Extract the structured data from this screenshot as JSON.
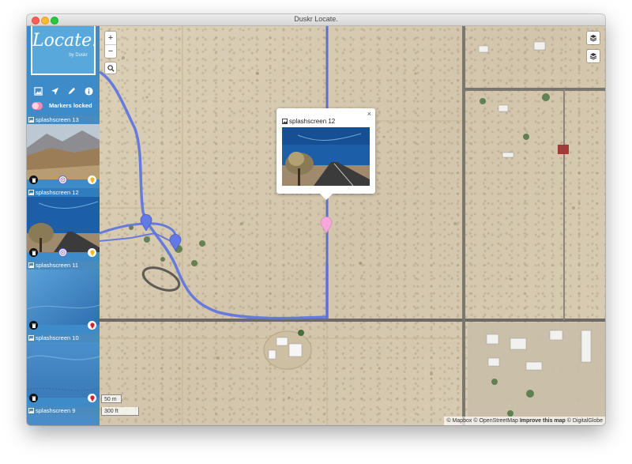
{
  "window": {
    "title": "Duskr Locate."
  },
  "sidebar": {
    "logo": {
      "text": "Locate.",
      "byline": "by Duskr"
    },
    "markers_locked": {
      "label": "Markers locked"
    },
    "screenshots": [
      {
        "label": "splashscreen 13"
      },
      {
        "label": "splashscreen 12"
      },
      {
        "label": "splashscreen 11"
      },
      {
        "label": "splashscreen 10"
      },
      {
        "label": "splashscreen 9"
      }
    ]
  },
  "map": {
    "zoom_in": "+",
    "zoom_out": "−",
    "scale": {
      "metric": "50 m",
      "imperial": "300 ft"
    },
    "attribution": {
      "mapbox": "© Mapbox",
      "osm": "© OpenStreetMap",
      "improve": "Improve this map",
      "digitalglobe": "© DigitalGlobe"
    }
  },
  "popup": {
    "title": "splashscreen 12",
    "close": "×"
  },
  "colors": {
    "sidebar": "#3e8bc9",
    "route": "#5a72e0",
    "marker_blue": "#6479e6",
    "marker_pink": "#f6a8d8",
    "toggle": "#f28cb3",
    "pin_yellow": "#f3b81d",
    "pin_red": "#d2212c"
  }
}
